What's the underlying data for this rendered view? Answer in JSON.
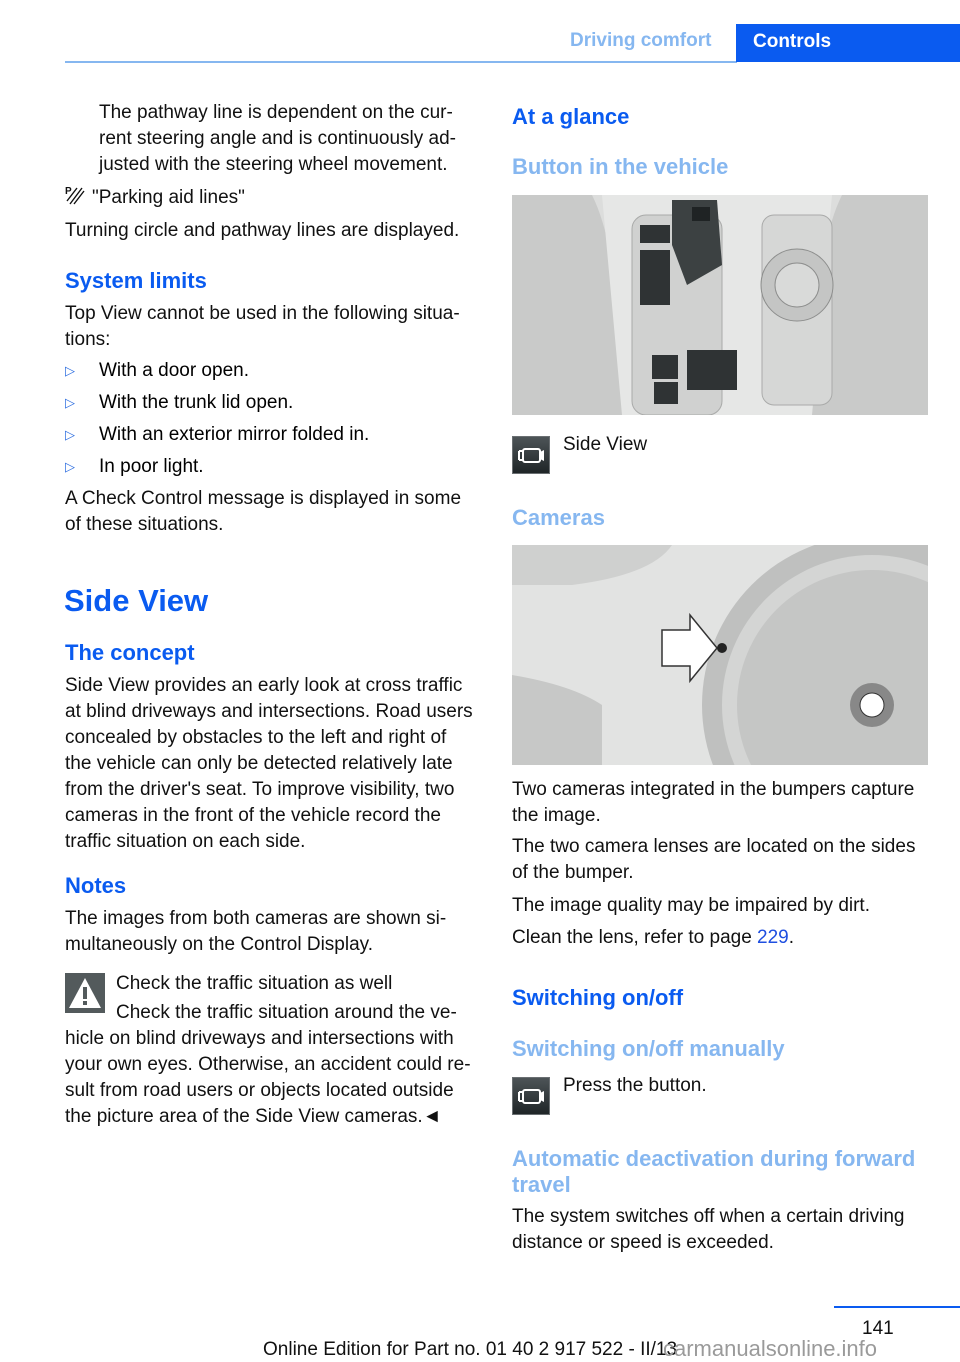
{
  "header": {
    "section": "Driving comfort",
    "chapter": "Controls",
    "accent_color": "#0a5bf0",
    "light_accent_color": "#86b7f0"
  },
  "left": {
    "intro_paragraph": "The pathway line is dependent on the current steering angle and is continuously adjusted with the steering wheel movement.",
    "intro_lines": [
      "The pathway line is dependent on the cur-",
      "rent steering angle and is continuously ad-",
      "justed with the steering wheel movement."
    ],
    "parking_aid_label": "\"Parking aid lines\"",
    "parking_aid_text": "Turning circle and pathway lines are displayed.",
    "system_limits": {
      "heading": "System limits",
      "intro_lines": [
        "Top View cannot be used in the following situa-",
        "tions:"
      ],
      "items": [
        "With a door open.",
        "With the trunk lid open.",
        "With an exterior mirror folded in.",
        "In poor light."
      ],
      "outro_lines": [
        "A Check Control message is displayed in some",
        "of these situations."
      ]
    },
    "side_view": {
      "heading": "Side View",
      "concept_heading": "The concept",
      "concept_lines": [
        "Side View provides an early look at cross traffic",
        "at blind driveways and intersections. Road users",
        "concealed by obstacles to the left and right of",
        "the vehicle can only be detected relatively late",
        "from the driver's seat. To improve visibility, two",
        "cameras in the front of the vehicle record the",
        "traffic situation on each side."
      ],
      "notes_heading": "Notes",
      "notes_lines": [
        "The images from both cameras are shown si-",
        "multaneously on the Control Display."
      ],
      "warning_title": "Check the traffic situation as well",
      "warning_lines": [
        "Check the traffic situation around the ve-",
        "hicle on blind driveways and intersections with",
        "your own eyes. Otherwise, an accident could re-",
        "sult from road users or objects located outside",
        "the picture area of the Side View cameras.◄"
      ]
    }
  },
  "right": {
    "at_a_glance_heading": "At a glance",
    "button_heading": "Button in the vehicle",
    "button_caption": "Side View",
    "cameras_heading": "Cameras",
    "cameras_lines": [
      "Two cameras integrated in the bumpers capture",
      "the image."
    ],
    "lenses_lines": [
      "The two camera lenses are located on the sides",
      "of the bumper."
    ],
    "dirt_text": "The image quality may be impaired by dirt.",
    "clean_prefix": "Clean the lens, refer to page ",
    "clean_page_link": "229",
    "clean_suffix": ".",
    "switching_heading": "Switching on/off",
    "manual_heading": "Switching on/off manually",
    "press_text": "Press the button.",
    "auto_heading_lines": [
      "Automatic deactivation during forward",
      "travel"
    ],
    "auto_lines": [
      "The system switches off when a certain driving",
      "distance or speed is exceeded."
    ]
  },
  "footer": {
    "page_number": "141",
    "edition": "Online Edition for Part no. 01 40 2 917 522 - II/13",
    "watermark": "carmanualsonline.info"
  },
  "icons": {
    "parking_aid": "parking-aid-lines-icon",
    "bullet": "triangle-bullet",
    "warning": "warning-triangle-icon",
    "side_view_button": "side-view-camera-icon"
  }
}
